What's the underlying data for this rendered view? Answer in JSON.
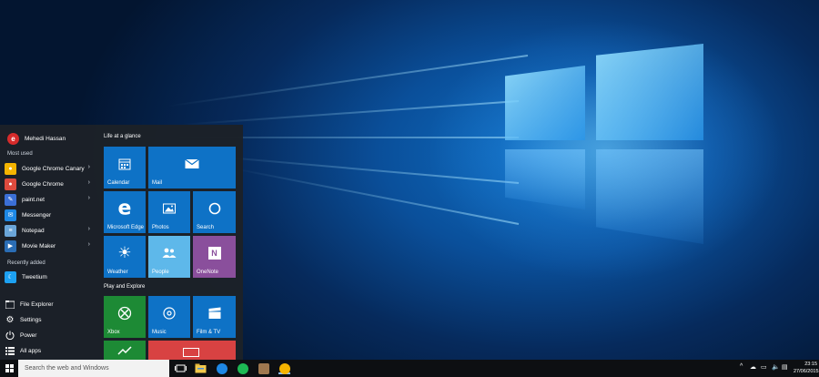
{
  "user": {
    "name": "Mehedi Hassan"
  },
  "most_used": {
    "heading": "Most used",
    "items": [
      {
        "label": "Google Chrome Canary",
        "icon": "chrome-canary-icon",
        "color": "#f5b400",
        "chevron": true
      },
      {
        "label": "Google Chrome",
        "icon": "chrome-icon",
        "color": "#dd4b3e",
        "chevron": true
      },
      {
        "label": "paint.net",
        "icon": "paintnet-icon",
        "color": "#3b6fd6",
        "chevron": true
      },
      {
        "label": "Messenger",
        "icon": "messenger-icon",
        "color": "#1e88e5",
        "chevron": false
      },
      {
        "label": "Notepad",
        "icon": "notepad-icon",
        "color": "#6aa5d8",
        "chevron": true
      },
      {
        "label": "Movie Maker",
        "icon": "movie-maker-icon",
        "color": "#2a6db5",
        "chevron": true
      }
    ]
  },
  "recently_added": {
    "heading": "Recently added",
    "items": [
      {
        "label": "Tweetium",
        "icon": "tweetium-icon",
        "color": "#1da1f2"
      }
    ]
  },
  "system_links": [
    {
      "label": "File Explorer",
      "icon": "file-explorer-icon"
    },
    {
      "label": "Settings",
      "icon": "settings-icon"
    },
    {
      "label": "Power",
      "icon": "power-icon"
    },
    {
      "label": "All apps",
      "icon": "all-apps-icon"
    }
  ],
  "tile_groups": {
    "life": {
      "heading": "Life at a glance",
      "tiles": {
        "calendar": "Calendar",
        "mail": "Mail",
        "edge": "Microsoft Edge",
        "photos": "Photos",
        "search": "Search",
        "weather": "Weather",
        "people": "People",
        "onenote": "OneNote"
      }
    },
    "play": {
      "heading": "Play and Explore",
      "tiles": {
        "xbox": "Xbox",
        "music": "Music",
        "film": "Film & TV"
      }
    }
  },
  "taskbar": {
    "search_placeholder": "Search the web and Windows",
    "time": "23:15",
    "date": "27/06/2015"
  },
  "colors": {
    "tile_blue": "#0e72c6",
    "tile_light_blue": "#5eb8ea",
    "tile_purple": "#8a4f9c",
    "tile_green": "#1d8a35",
    "tile_red": "#d84242",
    "start_bg": "#1c2128"
  }
}
